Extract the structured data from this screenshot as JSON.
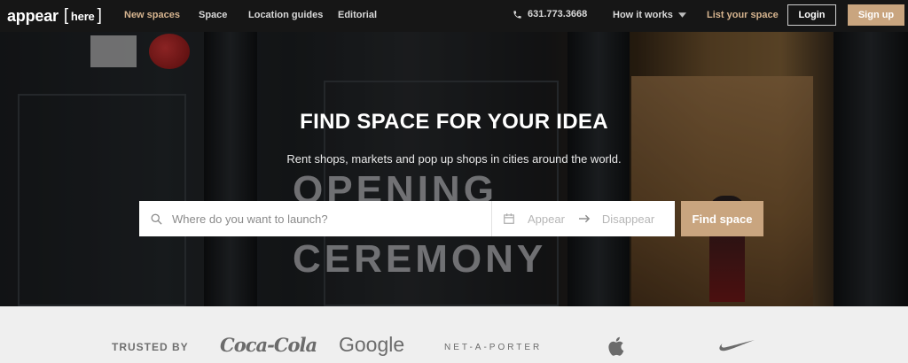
{
  "nav": {
    "logo_main": "appear",
    "logo_here": "here",
    "links": [
      {
        "label": "New spaces",
        "accent": true
      },
      {
        "label": "Space",
        "accent": false
      },
      {
        "label": "Location guides",
        "accent": false
      },
      {
        "label": "Editorial",
        "accent": false
      }
    ],
    "phone": "631.773.3668",
    "how_it_works": "How it works",
    "list_your_space": "List your space",
    "login": "Login",
    "signup": "Sign up"
  },
  "hero": {
    "title": "FIND SPACE FOR YOUR IDEA",
    "subtitle": "Rent shops, markets and pop up shops in cities around the world.",
    "background_sign_lines": [
      "OPENING",
      "CEREMONY"
    ]
  },
  "search": {
    "location_placeholder": "Where do you want to launch?",
    "appear_placeholder": "Appear",
    "disappear_placeholder": "Disappear",
    "find_button": "Find space"
  },
  "trusted": {
    "label": "TRUSTED BY",
    "brands": [
      "Coca-Cola",
      "Google",
      "NET-A-PORTER",
      "Apple",
      "Nike"
    ]
  },
  "colors": {
    "accent": "#c9a57f",
    "nav_bg": "#161616",
    "trusted_bg": "#efefef"
  },
  "icons": [
    "phone-icon",
    "chevron-down-icon",
    "search-icon",
    "calendar-icon",
    "arrow-right-icon",
    "apple-logo-icon",
    "nike-swoosh-icon",
    "coca-cola-logo"
  ]
}
